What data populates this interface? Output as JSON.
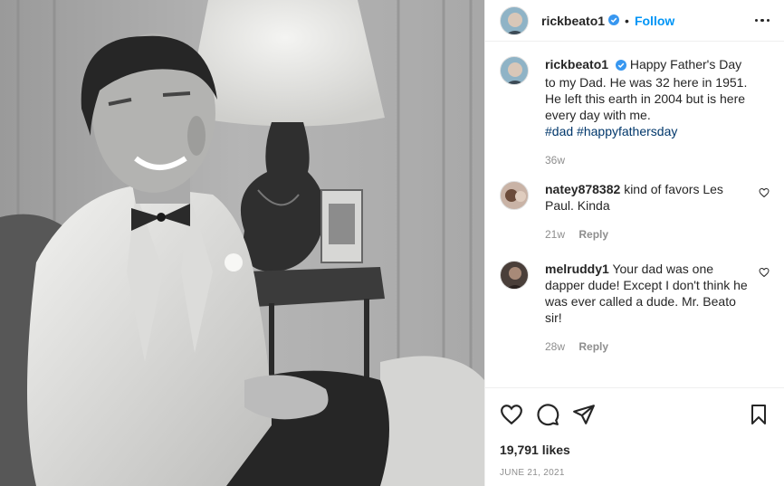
{
  "header": {
    "username": "rickbeato1",
    "separator": "•",
    "follow_label": "Follow"
  },
  "caption": {
    "username": "rickbeato1",
    "text": "Happy Father's Day to my Dad. He was 32 here in 1951. He left this earth in 2004 but is here every day with me.",
    "hashtags": [
      "#dad",
      "#happyfathersday"
    ],
    "time": "36w"
  },
  "comments": [
    {
      "username": "natey878382",
      "text": "kind of favors Les Paul. Kinda",
      "time": "21w",
      "reply_label": "Reply"
    },
    {
      "username": "melruddy1",
      "text": "Your dad was one dapper dude! Except I don't think he was ever called a dude. Mr. Beato sir!",
      "time": "28w",
      "reply_label": "Reply"
    }
  ],
  "likes": "19,791 likes",
  "date": "JUNE 21, 2021",
  "icons": {
    "like": "heart-icon",
    "comment": "comment-bubble-icon",
    "share": "paper-plane-icon",
    "save": "bookmark-icon",
    "more": "more-options-icon",
    "verified": "verified-badge-icon"
  },
  "colors": {
    "link_blue": "#0095f6",
    "hashtag": "#00376b",
    "muted": "#8e8e8e",
    "text": "#262626",
    "verified": "#3897f0"
  }
}
